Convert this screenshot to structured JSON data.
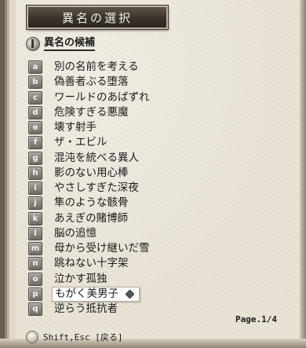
{
  "window": {
    "title": "異名の選択"
  },
  "section": {
    "label": "異名の候補"
  },
  "options": [
    {
      "key": "a",
      "label": "別の名前を考える"
    },
    {
      "key": "b",
      "label": "偽善者ぶる堕落"
    },
    {
      "key": "c",
      "label": "ワールドのあばずれ"
    },
    {
      "key": "d",
      "label": "危険すぎる悪魔"
    },
    {
      "key": "e",
      "label": "壊す射手"
    },
    {
      "key": "f",
      "label": "ザ・エビル"
    },
    {
      "key": "g",
      "label": "混沌を統べる異人"
    },
    {
      "key": "h",
      "label": "影のない用心棒"
    },
    {
      "key": "i",
      "label": "やさしすぎた深夜"
    },
    {
      "key": "j",
      "label": "隼のような骸骨"
    },
    {
      "key": "k",
      "label": "あえぎの賭博師"
    },
    {
      "key": "l",
      "label": "脳の追憶"
    },
    {
      "key": "m",
      "label": "母から受け継いだ雪"
    },
    {
      "key": "n",
      "label": "跳ねない十字架"
    },
    {
      "key": "o",
      "label": "泣かす孤独"
    },
    {
      "key": "p",
      "label": "もがく美男子"
    },
    {
      "key": "q",
      "label": "逆らう抵抗者"
    }
  ],
  "selected_key": "p",
  "page": {
    "text": "Page.1/4"
  },
  "footer": {
    "hint": "Shift,Esc [戻る]"
  },
  "icons": {
    "section": "info-icon",
    "footer": "bulb-icon",
    "cursor": "diamond-cursor-icon"
  }
}
